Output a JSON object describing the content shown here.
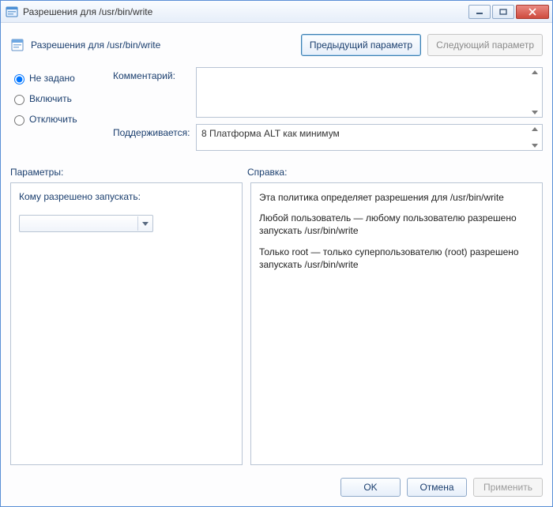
{
  "window": {
    "title": "Разрешения для /usr/bin/write"
  },
  "header": {
    "title": "Разрешения для /usr/bin/write",
    "prev_label": "Предыдущий параметр",
    "next_label": "Следующий параметр"
  },
  "state": {
    "options": {
      "not_configured": "Не задано",
      "enabled": "Включить",
      "disabled": "Отключить"
    }
  },
  "fields": {
    "comment_label": "Комментарий:",
    "supported_label": "Поддерживается:",
    "supported_value": "8 Платформа ALT как минимум"
  },
  "sections": {
    "params_label": "Параметры:",
    "help_label": "Справка:"
  },
  "params": {
    "who_label": "Кому разрешено запускать:",
    "combo_value": ""
  },
  "help": {
    "p1": "Эта политика определяет разрешения для /usr/bin/write",
    "p2": "Любой пользователь — любому пользователю разрешено запускать /usr/bin/write",
    "p3": "Только root — только суперпользователю (root) разрешено запускать /usr/bin/write"
  },
  "footer": {
    "ok": "OK",
    "cancel": "Отмена",
    "apply": "Применить"
  }
}
